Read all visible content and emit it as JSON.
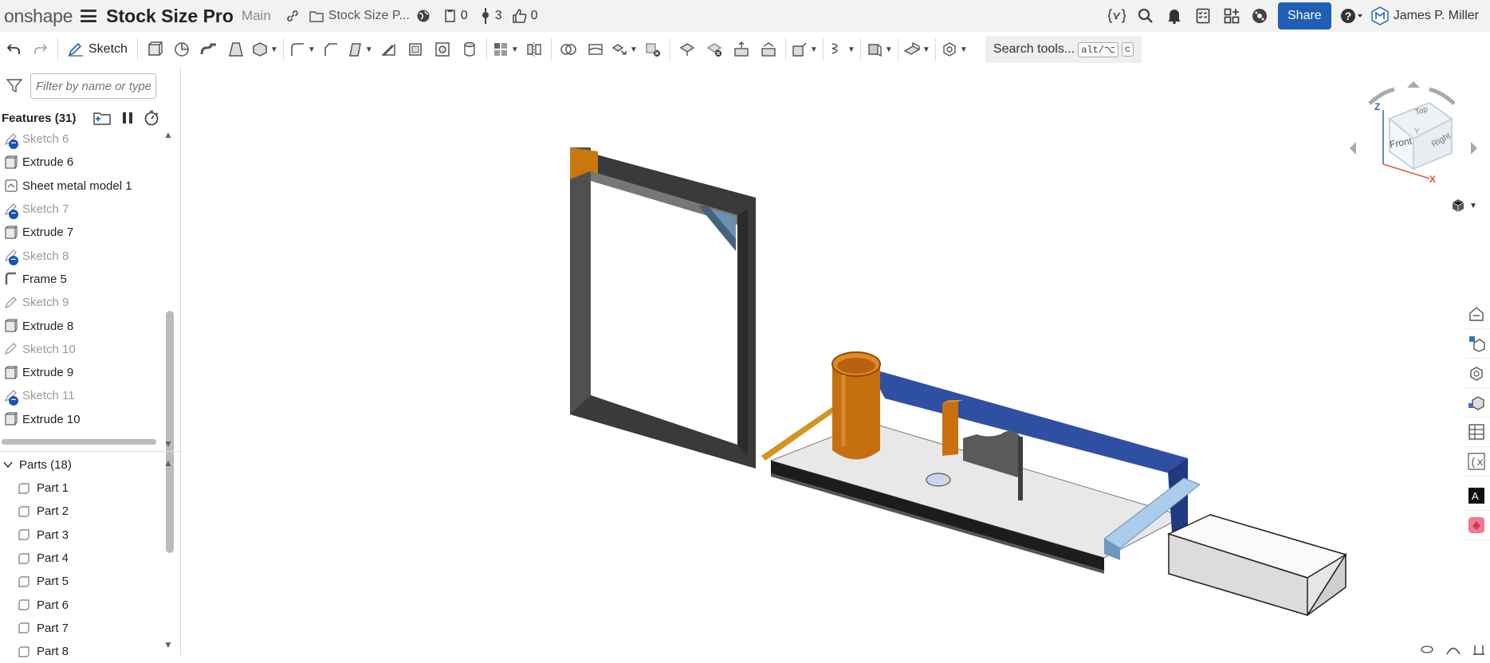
{
  "app": {
    "logo": "onshape",
    "doc_title": "Stock Size Pro",
    "branch": "Main",
    "folder": "Stock Size P...",
    "count_workspace": "0",
    "count_versions": "3",
    "count_likes": "0",
    "share_label": "Share",
    "user_name": "James P. Miller"
  },
  "toolbar": {
    "sketch_label": "Sketch",
    "search_label": "Search tools...",
    "search_shortcut_1": "alt/⌥",
    "search_shortcut_2": "c"
  },
  "left": {
    "filter_placeholder": "Filter by name or type",
    "features_header": "Features (31)",
    "features": [
      {
        "label": "Sketch 6",
        "kind": "sketch-disabled"
      },
      {
        "label": "Extrude 6",
        "kind": "extrude"
      },
      {
        "label": "Sheet metal model 1",
        "kind": "sheetmetal"
      },
      {
        "label": "Sketch 7",
        "kind": "sketch-disabled"
      },
      {
        "label": "Extrude 7",
        "kind": "extrude"
      },
      {
        "label": "Sketch 8",
        "kind": "sketch-disabled"
      },
      {
        "label": "Frame 5",
        "kind": "frame"
      },
      {
        "label": "Sketch 9",
        "kind": "sketch"
      },
      {
        "label": "Extrude 8",
        "kind": "extrude"
      },
      {
        "label": "Sketch 10",
        "kind": "sketch"
      },
      {
        "label": "Extrude 9",
        "kind": "extrude"
      },
      {
        "label": "Sketch 11",
        "kind": "sketch-disabled"
      },
      {
        "label": "Extrude 10",
        "kind": "extrude"
      }
    ],
    "parts_header": "Parts (18)",
    "parts": [
      "Part 1",
      "Part 2",
      "Part 3",
      "Part 4",
      "Part 5",
      "Part 6",
      "Part 7",
      "Part 8"
    ]
  },
  "viewcube": {
    "top": "Top",
    "front": "Front",
    "right": "Right",
    "axis_z": "Z",
    "axis_x": "X",
    "axis_y": "Y"
  },
  "colors": {
    "accent": "#1f5fb6",
    "orange": "#c8700e",
    "blue": "#2d4fa0",
    "light_blue": "#9cc4e4",
    "dark_frame": "#3c3c3c"
  }
}
